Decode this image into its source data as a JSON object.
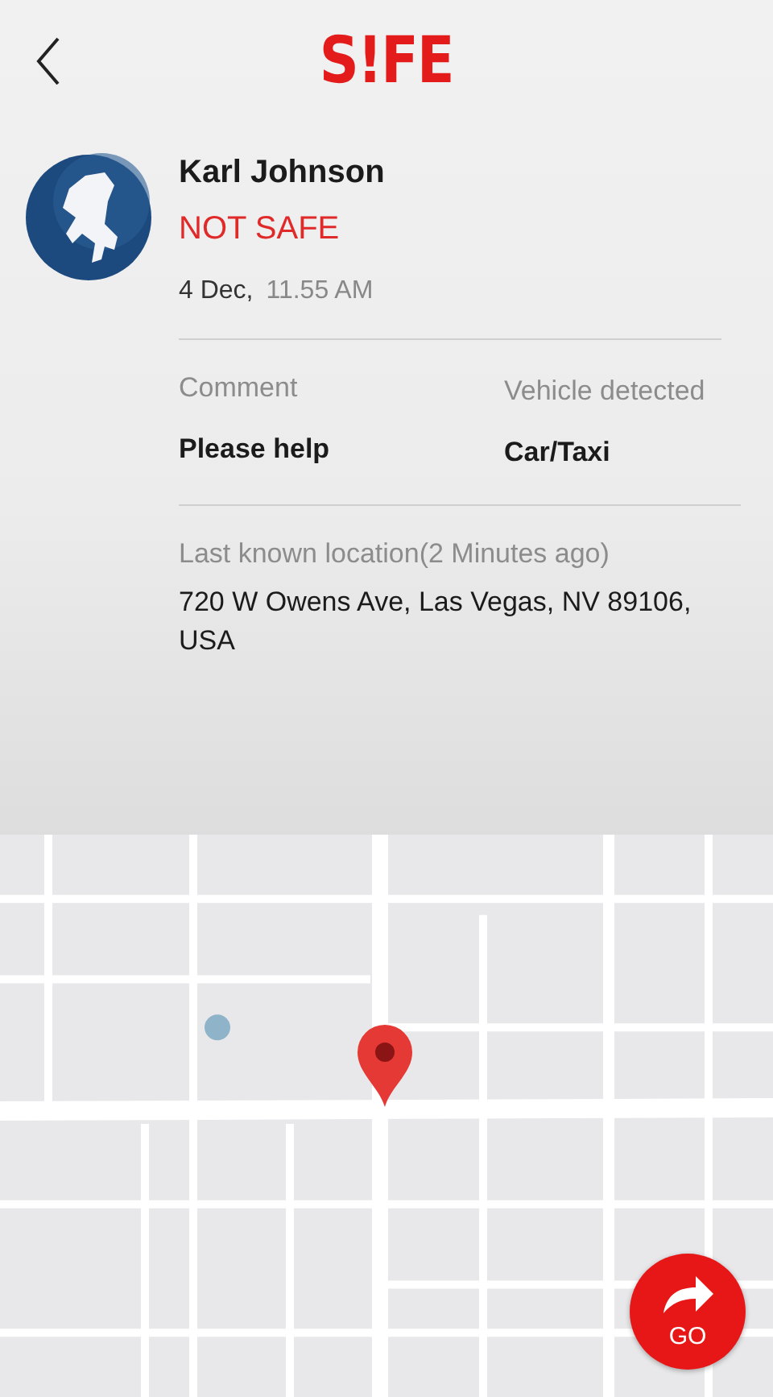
{
  "header": {
    "logo": "S!FE"
  },
  "contact": {
    "name": "Karl Johnson",
    "status": "NOT SAFE",
    "date": "4 Dec,",
    "time": "11.55 AM"
  },
  "details": [
    {
      "label": "Comment",
      "value": "Please help"
    },
    {
      "label": "Vehicle detected",
      "value": "Car/Taxi"
    }
  ],
  "location": {
    "label": "Last known location(2 Minutes ago)",
    "address": "720 W Owens Ave, Las Vegas, NV 89106, USA"
  },
  "map": {
    "kind": "picture",
    "go": "GO"
  }
}
